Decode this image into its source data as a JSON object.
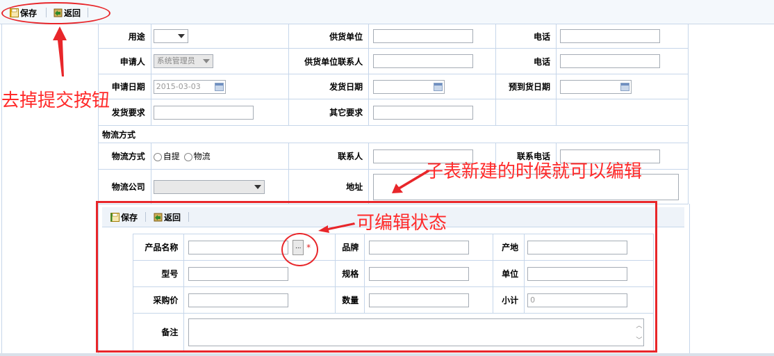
{
  "toolbar": {
    "save_label": "保存",
    "back_label": "返回"
  },
  "form": {
    "purpose_label": "用途",
    "supplier_label": "供货单位",
    "phone_label": "电话",
    "applicant_label": "申请人",
    "applicant_value": "系统管理员",
    "supplier_contact_label": "供货单位联系人",
    "phone2_label": "电话",
    "apply_date_label": "申请日期",
    "apply_date_value": "2015-03-03",
    "ship_date_label": "发货日期",
    "arrival_date_label": "预到货日期",
    "ship_req_label": "发货要求",
    "other_req_label": "其它要求",
    "logistics_section": "物流方式",
    "logistics_method_label": "物流方式",
    "opt_self": "自提",
    "opt_logistics": "物流",
    "contact_label": "联系人",
    "contact_phone_label": "联系电话",
    "logistics_company_label": "物流公司",
    "address_label": "地址"
  },
  "subform": {
    "save_label": "保存",
    "back_label": "返回",
    "product_name_label": "产品名称",
    "picker_label": "...",
    "required_mark": "*",
    "brand_label": "品牌",
    "origin_label": "产地",
    "model_label": "型号",
    "spec_label": "规格",
    "unit_label": "单位",
    "price_label": "采购价",
    "qty_label": "数量",
    "subtotal_label": "小计",
    "subtotal_value": "0",
    "remark_label": "备注"
  },
  "annotations": {
    "remove_submit": "去掉提交按钮",
    "subtable_editable": "子表新建的时候就可以编辑",
    "editable_state": "可编辑状态"
  },
  "colors": {
    "annotation": "#e8262a",
    "border": "#c6d6ea"
  }
}
